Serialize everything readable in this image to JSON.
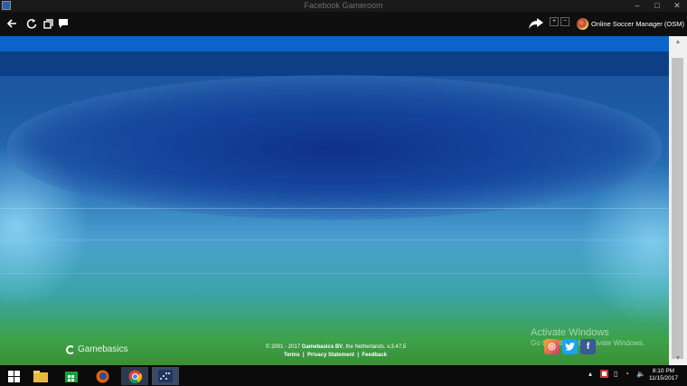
{
  "window": {
    "title": "Facebook Gameroom"
  },
  "toolbar": {
    "game_name": "Online Soccer Manager (OSM)",
    "zoom_in": "+",
    "zoom_out": "−"
  },
  "footer": {
    "brand": "Gamebasics",
    "copyright_prefix": "© 2001 - 2017 ",
    "copyright_company": "Gamebasics BV",
    "copyright_suffix": ", the Netherlands. v.3.47.5",
    "links": [
      "Terms",
      "Privacy Statement",
      "Feedback"
    ],
    "separator": "|"
  },
  "watermark": {
    "line1": "Activate Windows",
    "line2": "Go to Settings to activate Windows."
  },
  "social": [
    {
      "name": "instagram",
      "glyph": "◎",
      "color": "#d9743a"
    },
    {
      "name": "twitter",
      "glyph": "🐦",
      "color": "#1da1f2"
    },
    {
      "name": "facebook",
      "glyph": "f",
      "color": "#3b5998"
    }
  ],
  "clock": {
    "time": "8:10 PM",
    "date": "11/15/2017"
  },
  "colors": {
    "accent_blue": "#0a64c9",
    "dark_blue": "#0c3f85",
    "field_green": "#3da24a"
  }
}
